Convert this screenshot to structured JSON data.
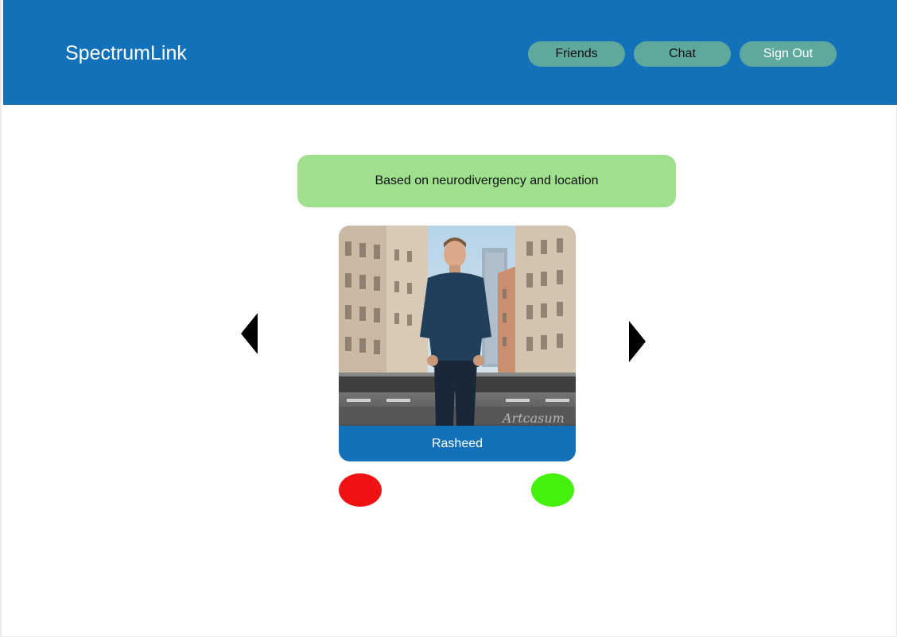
{
  "header": {
    "brand": "SpectrumLink",
    "nav": {
      "friends": "Friends",
      "chat": "Chat",
      "sign_out": "Sign Out"
    }
  },
  "main": {
    "match_basis": "Based on neurodivergency and location",
    "profile": {
      "name": "Rasheed",
      "photo_watermark": "Artcasum"
    },
    "icons": {
      "previous": "triangle-left-icon",
      "next": "triangle-right-icon",
      "reject": "red-circle",
      "accept": "green-circle"
    }
  },
  "colors": {
    "header_bg": "#1271b9",
    "nav_button_bg": "#5fa89e",
    "banner_bg": "#9fe08f",
    "reject": "#f01212",
    "accept": "#46f00e"
  }
}
